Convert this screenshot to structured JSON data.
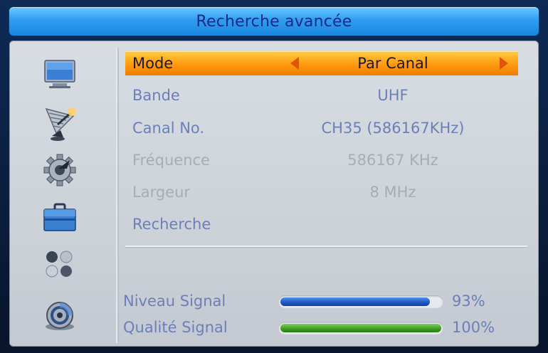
{
  "title": "Recherche avancée",
  "sidebar": {
    "icons": [
      "tv-icon",
      "satellite-dish-icon",
      "gear-icon",
      "toolbox-icon",
      "games-icon",
      "media-disc-icon"
    ]
  },
  "menu": {
    "rows": [
      {
        "label": "Mode",
        "value": "Par Canal"
      },
      {
        "label": "Bande",
        "value": "UHF"
      },
      {
        "label": "Canal No.",
        "value": "CH35 (586167KHz)"
      },
      {
        "label": "Fréquence",
        "value": "586167 KHz"
      },
      {
        "label": "Largeur",
        "value": "8 MHz"
      },
      {
        "label": "Recherche",
        "value": ""
      }
    ]
  },
  "signal": {
    "level_label": "Niveau Signal",
    "level_value": "93%",
    "level_fraction": 0.93,
    "quality_label": "Qualité Signal",
    "quality_value": "100%",
    "quality_fraction": 1.0
  },
  "colors": {
    "highlight": "#ff9a10",
    "text_active": "#6b80b8",
    "text_disabled": "#a7adb6",
    "bar_level": "#1e55c4",
    "bar_quality": "#3c9b22"
  }
}
